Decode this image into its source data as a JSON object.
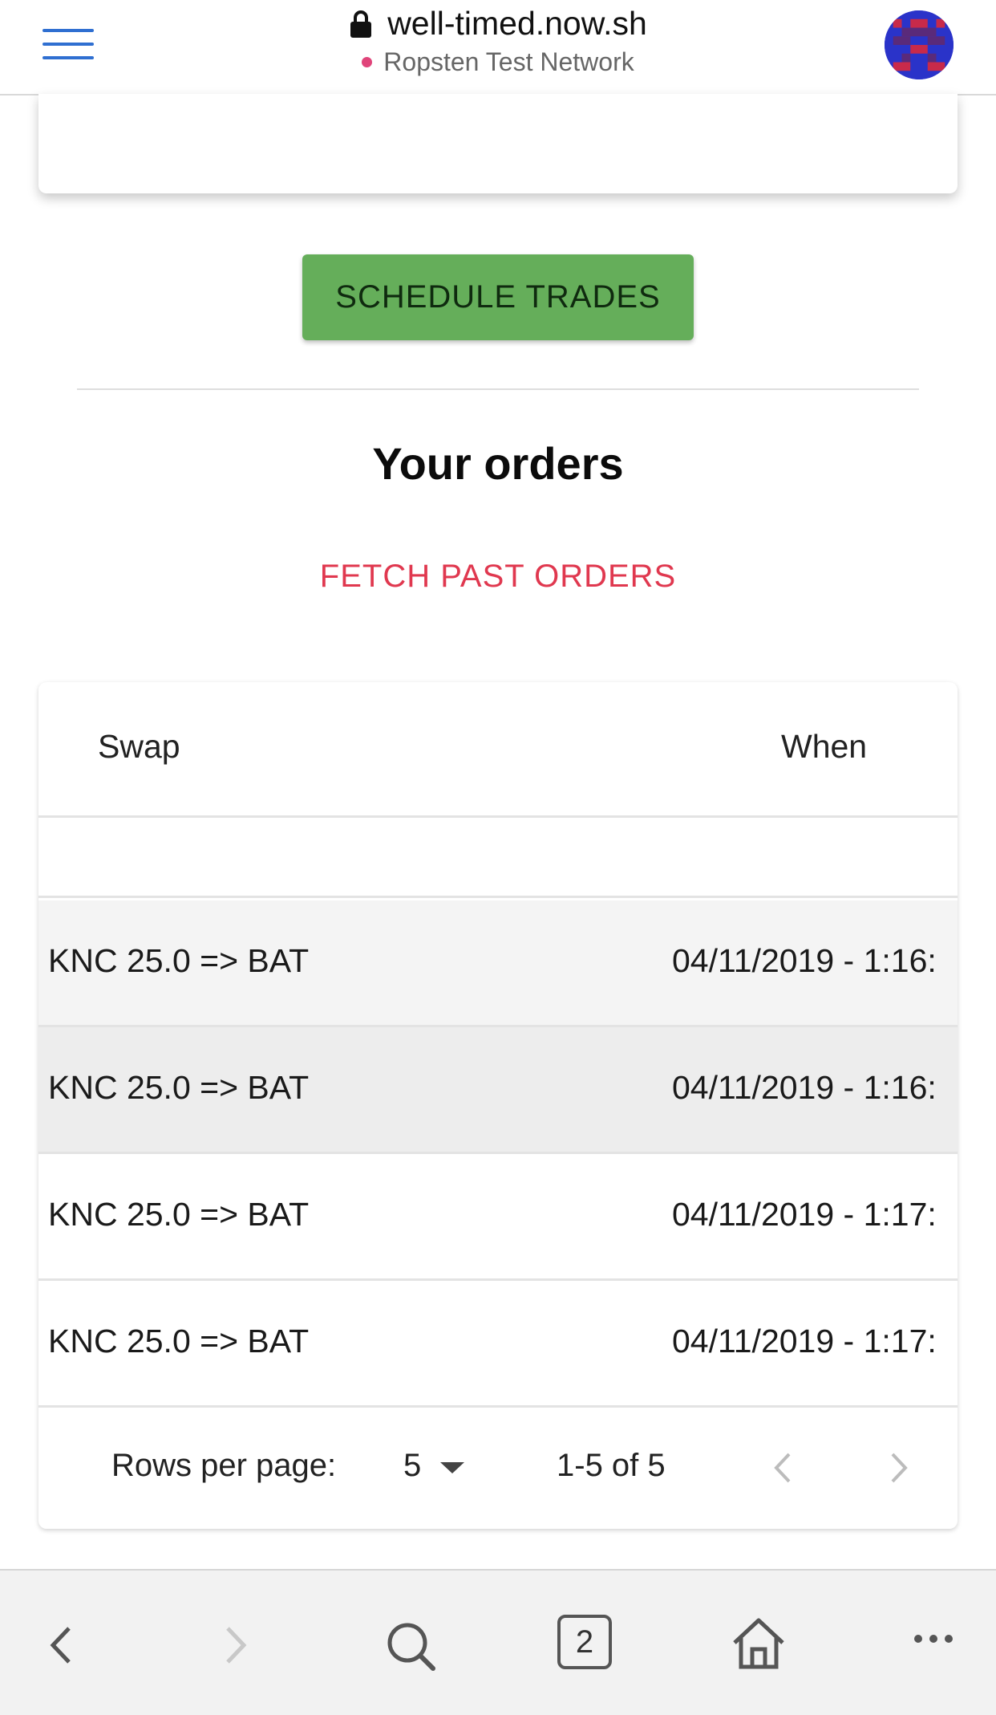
{
  "browser": {
    "url": "well-timed.now.sh",
    "network": "Ropsten Test Network",
    "tab_count": "2"
  },
  "actions": {
    "schedule_label": "SCHEDULE TRADES",
    "fetch_label": "FETCH PAST ORDERS"
  },
  "orders": {
    "title": "Your orders",
    "columns": {
      "swap": "Swap",
      "when": "When"
    },
    "rows": [
      {
        "swap": "KNC 25.0 => BAT",
        "when": "04/11/2019 - 1:16:"
      },
      {
        "swap": "KNC 25.0 => BAT",
        "when": "04/11/2019 - 1:16:"
      },
      {
        "swap": "KNC 25.0 => BAT",
        "when": "04/11/2019 - 1:17:"
      },
      {
        "swap": "KNC 25.0 => BAT",
        "when": "04/11/2019 - 1:17:"
      }
    ],
    "pagination": {
      "rows_per_page_label": "Rows per page:",
      "rows_per_page_value": "5",
      "range": "1-5 of 5"
    }
  },
  "colors": {
    "accent_blue": "#2f6fd1",
    "schedule_green": "#65ae5a",
    "fetch_red": "#e0384f",
    "network_dot": "#e0447a"
  }
}
